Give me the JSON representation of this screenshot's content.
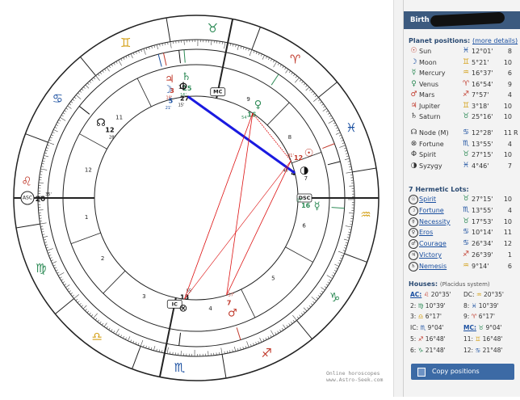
{
  "sidebar": {
    "birth_label": "Birth",
    "planet_positions_title": "Planet positions:",
    "more_details_link": "(more details)",
    "planets": [
      {
        "glyph": "☉",
        "color": "#c0392b",
        "name": "Sun",
        "sign": "♓",
        "sign_color": "#1a4fa0",
        "deg": "12°01'",
        "house": "8",
        "rx": ""
      },
      {
        "glyph": "☽",
        "color": "#1a4fa0",
        "name": "Moon",
        "sign": "♊",
        "sign_color": "#d4a017",
        "deg": "5°21'",
        "house": "10",
        "rx": ""
      },
      {
        "glyph": "☿",
        "color": "#2e8b57",
        "name": "Mercury",
        "sign": "♒",
        "sign_color": "#d4a017",
        "deg": "16°37'",
        "house": "6",
        "rx": ""
      },
      {
        "glyph": "♀",
        "color": "#2e8b57",
        "name": "Venus",
        "sign": "♈",
        "sign_color": "#c0392b",
        "deg": "16°54'",
        "house": "9",
        "rx": ""
      },
      {
        "glyph": "♂",
        "color": "#c0392b",
        "name": "Mars",
        "sign": "♐",
        "sign_color": "#c0392b",
        "deg": "7°57'",
        "house": "4",
        "rx": ""
      },
      {
        "glyph": "♃",
        "color": "#c0392b",
        "name": "Jupiter",
        "sign": "♊",
        "sign_color": "#d4a017",
        "deg": "3°18'",
        "house": "10",
        "rx": ""
      },
      {
        "glyph": "♄",
        "color": "#333333",
        "name": "Saturn",
        "sign": "♉",
        "sign_color": "#2e8b57",
        "deg": "25°16'",
        "house": "10",
        "rx": ""
      }
    ],
    "points": [
      {
        "glyph": "☊",
        "color": "#333333",
        "name": "Node (M)",
        "sign": "♋",
        "sign_color": "#1a4fa0",
        "deg": "12°28'",
        "house": "11",
        "rx": "R"
      },
      {
        "glyph": "⊗",
        "color": "#333333",
        "name": "Fortune",
        "sign": "♏",
        "sign_color": "#1a4fa0",
        "deg": "13°55'",
        "house": "4",
        "rx": ""
      },
      {
        "glyph": "Φ",
        "color": "#333333",
        "name": "Spirit",
        "sign": "♉",
        "sign_color": "#2e8b57",
        "deg": "27°15'",
        "house": "10",
        "rx": ""
      },
      {
        "glyph": "◑",
        "color": "#333333",
        "name": "Syzygy",
        "sign": "♓",
        "sign_color": "#1a4fa0",
        "deg": "4°46'",
        "house": "7",
        "rx": ""
      }
    ],
    "lots_title": "7 Hermetic Lots:",
    "lots": [
      {
        "icon": "☉",
        "name": "Spirit",
        "sign": "♉",
        "sign_color": "#2e8b57",
        "deg": "27°15'",
        "house": "10"
      },
      {
        "icon": "☽",
        "name": "Fortune",
        "sign": "♏",
        "sign_color": "#1a4fa0",
        "deg": "13°55'",
        "house": "4"
      },
      {
        "icon": "☿",
        "name": "Necessity",
        "sign": "♉",
        "sign_color": "#2e8b57",
        "deg": "17°53'",
        "house": "10"
      },
      {
        "icon": "♀",
        "name": "Eros",
        "sign": "♋",
        "sign_color": "#1a4fa0",
        "deg": "10°14'",
        "house": "11"
      },
      {
        "icon": "♂",
        "name": "Courage",
        "sign": "♋",
        "sign_color": "#1a4fa0",
        "deg": "26°34'",
        "house": "12"
      },
      {
        "icon": "♃",
        "name": "Victory",
        "sign": "♐",
        "sign_color": "#c0392b",
        "deg": "26°39'",
        "house": "1"
      },
      {
        "icon": "♄",
        "name": "Nemesis",
        "sign": "♒",
        "sign_color": "#d4a017",
        "deg": "9°14'",
        "house": "6"
      }
    ],
    "houses_title": "Houses:",
    "houses_system": "(Placidus system)",
    "houses": [
      {
        "label": "AC:",
        "sign": "♌",
        "sign_color": "#c0392b",
        "deg": "20°35'",
        "link": true
      },
      {
        "label": "DC:",
        "sign": "♒",
        "sign_color": "#d4a017",
        "deg": "20°35'",
        "link": false
      },
      {
        "label": "2:",
        "sign": "♍",
        "sign_color": "#2e8b57",
        "deg": "10°39'",
        "link": false
      },
      {
        "label": "8:",
        "sign": "♓",
        "sign_color": "#1a4fa0",
        "deg": "10°39'",
        "link": false
      },
      {
        "label": "3:",
        "sign": "♎",
        "sign_color": "#d4a017",
        "deg": "6°17'",
        "link": false
      },
      {
        "label": "9:",
        "sign": "♈",
        "sign_color": "#c0392b",
        "deg": "6°17'",
        "link": false
      },
      {
        "label": "IC:",
        "sign": "♏",
        "sign_color": "#1a4fa0",
        "deg": "9°04'",
        "link": false
      },
      {
        "label": "MC:",
        "sign": "♉",
        "sign_color": "#2e8b57",
        "deg": "9°04'",
        "link": true
      },
      {
        "label": "5:",
        "sign": "♐",
        "sign_color": "#c0392b",
        "deg": "16°48'",
        "link": false
      },
      {
        "label": "11:",
        "sign": "♊",
        "sign_color": "#d4a017",
        "deg": "16°48'",
        "link": false
      },
      {
        "label": "6:",
        "sign": "♑",
        "sign_color": "#2e8b57",
        "deg": "21°48'",
        "link": false
      },
      {
        "label": "12:",
        "sign": "♋",
        "sign_color": "#1a4fa0",
        "deg": "21°48'",
        "link": false
      }
    ],
    "copy_button": "Copy positions"
  },
  "chart": {
    "watermark_line1": "Online horoscopes",
    "watermark_line2": "www.Astro-Seek.com",
    "asc_label": "ASC",
    "asc_deg": "20",
    "asc_min": "35'",
    "dsc_label": "DSC",
    "mc_label": "MC",
    "ic_label": "IC",
    "signs": [
      {
        "glyph": "♈",
        "color": "#c0392b"
      },
      {
        "glyph": "♉",
        "color": "#2e8b57"
      },
      {
        "glyph": "♊",
        "color": "#d4a017"
      },
      {
        "glyph": "♋",
        "color": "#1a4fa0"
      },
      {
        "glyph": "♌",
        "color": "#c0392b"
      },
      {
        "glyph": "♍",
        "color": "#2e8b57"
      },
      {
        "glyph": "♎",
        "color": "#d4a017"
      },
      {
        "glyph": "♏",
        "color": "#1a4fa0"
      },
      {
        "glyph": "♐",
        "color": "#c0392b"
      },
      {
        "glyph": "♑",
        "color": "#2e8b57"
      },
      {
        "glyph": "♒",
        "color": "#d4a017"
      },
      {
        "glyph": "♓",
        "color": "#1a4fa0"
      }
    ],
    "house_numbers": [
      "1",
      "2",
      "3",
      "4",
      "5",
      "6",
      "7",
      "8",
      "9",
      "10",
      "11",
      "12"
    ],
    "planet_marks": [
      {
        "glyph": "☉",
        "deg": "12",
        "min": "01'",
        "color": "#c0392b",
        "lon": 342.02
      },
      {
        "glyph": "◑",
        "deg": "4",
        "min": "46'",
        "color": "#111111",
        "lon": 334.77
      },
      {
        "glyph": "☿",
        "deg": "16",
        "min": "37'",
        "color": "#2e8b57",
        "lon": 316.62
      },
      {
        "glyph": "♀",
        "deg": "16",
        "min": "54'",
        "color": "#2e8b57",
        "lon": 16.9
      },
      {
        "glyph": "♄",
        "deg": "25",
        "min": "16'",
        "color": "#2e8b57",
        "lon": 55.27
      },
      {
        "glyph": "Φ",
        "deg": "27",
        "min": "15'",
        "color": "#111111",
        "lon": 57.25
      },
      {
        "glyph": "♃",
        "deg": "3",
        "min": "18'",
        "color": "#c0392b",
        "lon": 63.3
      },
      {
        "glyph": "☽",
        "deg": "5",
        "min": "21'",
        "color": "#1a4fa0",
        "lon": 65.35
      },
      {
        "glyph": "☊",
        "deg": "12",
        "min": "28'",
        "color": "#111111",
        "lon": 102.47
      },
      {
        "glyph": "⊗",
        "deg": "13",
        "min": "55'",
        "color": "#111111",
        "lon": 223.92
      },
      {
        "glyph": "♂",
        "deg": "7",
        "min": "57'",
        "color": "#c0392b",
        "lon": 247.95
      }
    ],
    "cusps": [
      140.58,
      160.65,
      186.28,
      219.07,
      256.8,
      291.8,
      320.58,
      340.65,
      6.28,
      39.07,
      76.8,
      111.8
    ]
  }
}
